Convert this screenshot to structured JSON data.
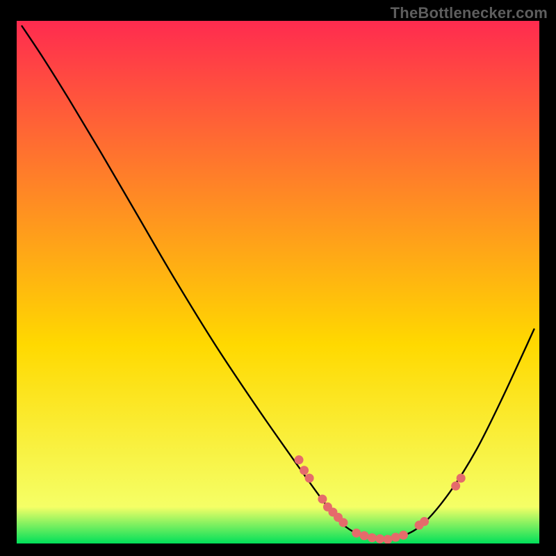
{
  "attribution": "TheBottlenecker.com",
  "chart_data": {
    "type": "line",
    "title": "",
    "xlabel": "",
    "ylabel": "",
    "xlim": [
      0,
      100
    ],
    "ylim": [
      0,
      100
    ],
    "background_gradient": {
      "top": "#ff2b4f",
      "mid": "#ffd900",
      "bottom": "#00e05a"
    },
    "curve": [
      {
        "x": 1,
        "y": 99
      },
      {
        "x": 5,
        "y": 93
      },
      {
        "x": 10,
        "y": 85
      },
      {
        "x": 16,
        "y": 75
      },
      {
        "x": 23,
        "y": 63
      },
      {
        "x": 30,
        "y": 51
      },
      {
        "x": 38,
        "y": 38
      },
      {
        "x": 46,
        "y": 26
      },
      {
        "x": 53,
        "y": 16
      },
      {
        "x": 58,
        "y": 9
      },
      {
        "x": 62,
        "y": 4
      },
      {
        "x": 66,
        "y": 1.5
      },
      {
        "x": 70,
        "y": 0.8
      },
      {
        "x": 74,
        "y": 1.5
      },
      {
        "x": 78,
        "y": 4
      },
      {
        "x": 83,
        "y": 10
      },
      {
        "x": 88,
        "y": 18
      },
      {
        "x": 93,
        "y": 28
      },
      {
        "x": 99,
        "y": 41
      }
    ],
    "markers": [
      {
        "x": 54,
        "y": 16
      },
      {
        "x": 55,
        "y": 14
      },
      {
        "x": 56,
        "y": 12.5
      },
      {
        "x": 58.5,
        "y": 8.5
      },
      {
        "x": 59.5,
        "y": 7
      },
      {
        "x": 60.5,
        "y": 6
      },
      {
        "x": 61.5,
        "y": 5
      },
      {
        "x": 62.5,
        "y": 4
      },
      {
        "x": 65,
        "y": 2
      },
      {
        "x": 66.5,
        "y": 1.5
      },
      {
        "x": 68,
        "y": 1.1
      },
      {
        "x": 69.5,
        "y": 0.9
      },
      {
        "x": 71,
        "y": 0.8
      },
      {
        "x": 72.5,
        "y": 1.2
      },
      {
        "x": 74,
        "y": 1.6
      },
      {
        "x": 77,
        "y": 3.5
      },
      {
        "x": 78,
        "y": 4.2
      },
      {
        "x": 84,
        "y": 11
      },
      {
        "x": 85,
        "y": 12.5
      }
    ],
    "marker_color": "#e56b6b",
    "marker_radius": 6.5
  }
}
